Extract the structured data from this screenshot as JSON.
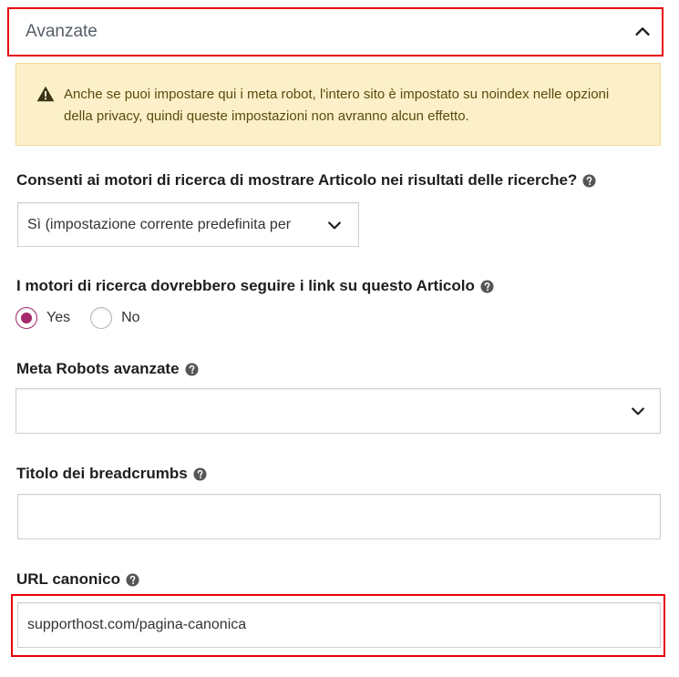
{
  "panel": {
    "title": "Avanzate"
  },
  "notice": {
    "text": "Anche se puoi impostare qui i meta robot, l'intero sito è impostato su noindex nelle opzioni della privacy, quindi queste impostazioni non avranno alcun effetto."
  },
  "fields": {
    "show_in_search": {
      "label": "Consenti ai motori di ricerca di mostrare Articolo nei risultati delle ricerche?",
      "value": "Sì (impostazione corrente predefinita per"
    },
    "follow_links": {
      "label": "I motori di ricerca dovrebbero seguire i link su questo Articolo",
      "options": [
        "Yes",
        "No"
      ],
      "selected": "Yes"
    },
    "meta_robots": {
      "label": "Meta Robots avanzate",
      "value": ""
    },
    "breadcrumbs_title": {
      "label": "Titolo dei breadcrumbs",
      "value": ""
    },
    "canonical_url": {
      "label": "URL canonico",
      "value": "supporthost.com/pagina-canonica"
    }
  },
  "colors": {
    "highlight": "#e8000b",
    "notice_bg": "#fbf0c8",
    "radio_accent": "#a4286a"
  },
  "icons": {
    "collapse": "chevron-up-icon",
    "warning": "warning-icon",
    "help": "help-circle-icon",
    "dropdown": "chevron-down-icon"
  }
}
